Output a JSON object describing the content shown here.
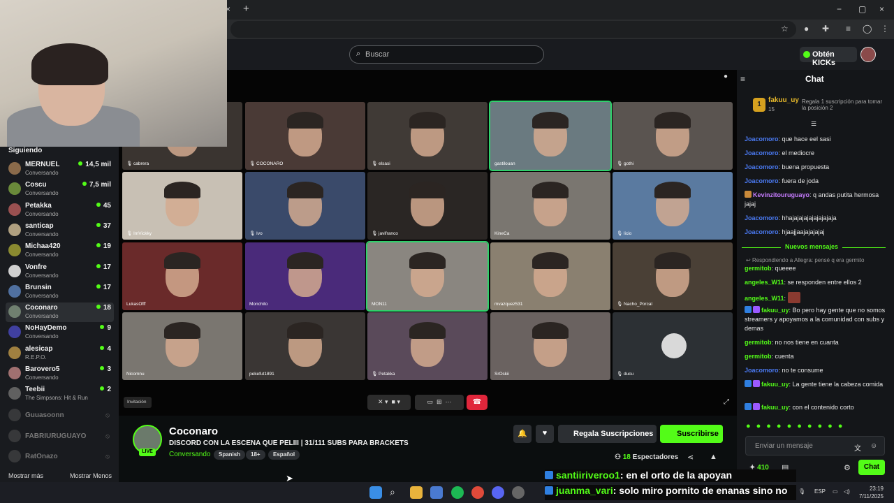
{
  "browser": {
    "tab_close": "×",
    "new_tab": "+",
    "window_controls": [
      "−",
      "▢",
      "×"
    ]
  },
  "header": {
    "search_placeholder": "Buscar",
    "get_kicks": "Obtén KICKs"
  },
  "sidebar": {
    "title": "Siguiendo",
    "channels": [
      {
        "name": "MERNUEL",
        "sub": "Conversando",
        "viewers": "14,5 mil",
        "color": "#8a6a4a"
      },
      {
        "name": "Coscu",
        "sub": "Conversando",
        "viewers": "7,5 mil",
        "color": "#6a8a3a"
      },
      {
        "name": "Petakka",
        "sub": "Conversando",
        "viewers": "45",
        "color": "#9a5050"
      },
      {
        "name": "santicap",
        "sub": "Conversando",
        "viewers": "37",
        "color": "#b0a080"
      },
      {
        "name": "Michaa420",
        "sub": "Conversando",
        "viewers": "19",
        "color": "#8a8a30"
      },
      {
        "name": "Vonfre",
        "sub": "Conversando",
        "viewers": "17",
        "color": "#d0d0d0"
      },
      {
        "name": "Brunsin",
        "sub": "Conversando",
        "viewers": "17",
        "color": "#5070a0"
      },
      {
        "name": "Coconaro",
        "sub": "Conversando",
        "viewers": "18",
        "color": "#708070"
      },
      {
        "name": "NoHayDemo",
        "sub": "Conversando",
        "viewers": "9",
        "color": "#4040a0"
      },
      {
        "name": "alesicap",
        "sub": "R.E.P.O.",
        "viewers": "4",
        "color": "#a08040"
      },
      {
        "name": "Barovero5",
        "sub": "Conversando",
        "viewers": "3",
        "color": "#a07070"
      },
      {
        "name": "Teebii",
        "sub": "The Simpsons: Hit & Run",
        "viewers": "2",
        "color": "#606060"
      }
    ],
    "offline": [
      {
        "name": "Guuasoonn"
      },
      {
        "name": "FABRIURUGUAYO"
      },
      {
        "name": "RatOnazo"
      }
    ],
    "show_more": "Mostrar más",
    "show_less": "Mostrar Menos"
  },
  "stream": {
    "tiles": [
      {
        "label": "🎙 cabrera",
        "bg": "#3a3430",
        "hl": false
      },
      {
        "label": "🎙 COCONARO",
        "bg": "#4a3a36",
        "hl": false
      },
      {
        "label": "🎙 elsasi",
        "bg": "#403a36",
        "hl": false
      },
      {
        "label": "gastilouan",
        "bg": "#6a7a80",
        "hl": true
      },
      {
        "label": "🎙 gothi",
        "bg": "#5a5450",
        "hl": false
      },
      {
        "label": "🎙 ImVickky",
        "bg": "#c8c0b4",
        "hl": false
      },
      {
        "label": "🎙 Ivo",
        "bg": "#3a4a6a",
        "hl": false
      },
      {
        "label": "🎙 javifranco",
        "bg": "#2a2624",
        "hl": false
      },
      {
        "label": "KineCa",
        "bg": "#7a7670",
        "hl": false
      },
      {
        "label": "🎙 licio",
        "bg": "#5a7aa0",
        "hl": false
      },
      {
        "label": "LukasOfff",
        "bg": "#6a2a2a",
        "hl": false
      },
      {
        "label": "Monchito",
        "bg": "#4a2a7a",
        "hl": false
      },
      {
        "label": "MON11",
        "bg": "#8a8680",
        "hl": true
      },
      {
        "label": "mvazquez531",
        "bg": "#8a8070",
        "hl": false
      },
      {
        "label": "🎙 Nacho_Porcal",
        "bg": "#4a4036",
        "hl": false
      },
      {
        "label": "Nicomnu",
        "bg": "#7a7670",
        "hl": false
      },
      {
        "label": "pekefut1891",
        "bg": "#3a3634",
        "hl": false
      },
      {
        "label": "🎙 Petakka",
        "bg": "#5a4a5a",
        "hl": false
      },
      {
        "label": "SrOskii",
        "bg": "#6a6260",
        "hl": false
      },
      {
        "label": "🎙 ducu",
        "bg": "#2c3034",
        "hl": false
      }
    ],
    "invite": "Invitación"
  },
  "info": {
    "streamer": "Coconaro",
    "title": "DISCORD CON LA ESCENA QUE PELIII | 31/111 SUBS PARA BRACKETS",
    "category": "Conversando",
    "tags": [
      "Spanish",
      "18+",
      "Español"
    ],
    "live": "LIVE",
    "gift_subs": "Regala Suscripciones",
    "subscribe": "Suscribirse",
    "viewers_count": "18",
    "viewers_label": "Espectadores"
  },
  "chat": {
    "title": "Chat",
    "pinned": {
      "rank": "1",
      "user": "fakuu_uy",
      "count": "15",
      "gift_text": "Regala 1 suscripción para tomar la posición 2"
    },
    "partial_line": "...",
    "messages_before": [
      {
        "user": "Joacomoro",
        "text": ": que hace eel sasi",
        "color": "#4b7bf5"
      },
      {
        "user": "Joacomoro",
        "text": ": el mediocre",
        "color": "#4b7bf5"
      },
      {
        "user": "Joacomoro",
        "text": ": buena propuesta",
        "color": "#4b7bf5"
      },
      {
        "user": "Joacomoro",
        "text": ": fuera de joda",
        "color": "#4b7bf5"
      },
      {
        "user": "Kevinzitouruguayo",
        "text": ": q andas putita hermosa jajaj",
        "color": "#c77cff"
      },
      {
        "user": "Joacomoro",
        "text": ": hhajajajajajajajajaja",
        "color": "#4b7bf5"
      },
      {
        "user": "Joacomoro",
        "text": ": hjaajjaajajajajaj",
        "color": "#4b7bf5"
      }
    ],
    "new_messages": "Nuevos mensajes",
    "reply_to": "Respondiendo a Allegra: pensé q era germito",
    "messages_after": [
      {
        "user": "germitob",
        "text": ": queeee",
        "color": "#53fc18"
      },
      {
        "user": "angeles_W11",
        "text": ": se responden entre ellos 2",
        "color": "#53fc18"
      },
      {
        "user": "angeles_W11",
        "text": ":",
        "color": "#53fc18"
      },
      {
        "user": "fakuu_uy",
        "text": ": Bo pero hay gente que no somos streamers y apoyamos a la comunidad con subs y demas",
        "color": "#53fc18"
      },
      {
        "user": "germitob",
        "text": ": no nos tiene en cuanta",
        "color": "#53fc18"
      },
      {
        "user": "germitob",
        "text": ": cuenta",
        "color": "#53fc18"
      },
      {
        "user": "Joacomoro",
        "text": ": no te consume",
        "color": "#4b7bf5"
      },
      {
        "user": "fakuu_uy",
        "text": ": La gente tiene la cabeza comida",
        "color": "#53fc18"
      },
      {
        "user": "fakuu_uy",
        "text": ": con el contenido corto",
        "color": "#53fc18"
      }
    ],
    "input_placeholder": "Enviar un mensaje",
    "points": "410",
    "send": "Chat"
  },
  "overlay_chat": [
    {
      "user": "santiiriveroo1",
      "text": ": en el orto de la apoyan"
    },
    {
      "user": "juanma_vari",
      "text": ": solo miro pornito de enanas sino no"
    }
  ],
  "taskbar": {
    "lang": "ESP",
    "time": "23:19",
    "date": "7/11/2025"
  }
}
